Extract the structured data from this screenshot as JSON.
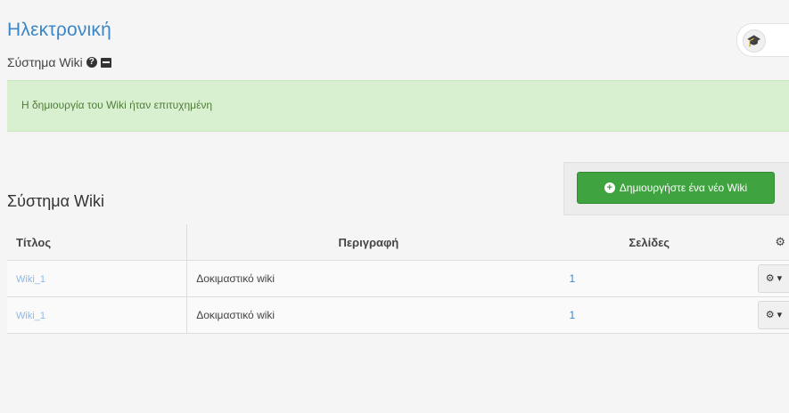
{
  "header": {
    "course_title": "Ηλεκτρονική",
    "tool_title": "Σύστημα Wiki",
    "help_icon": "question-circle-icon",
    "book_icon": "book-icon",
    "cap_icon": "graduation-cap-icon",
    "cap_glyph": "🎓"
  },
  "alert": {
    "message": "Η δημιουργία του Wiki ήταν επιτυχημένη",
    "color": "#d8f0cf"
  },
  "actions": {
    "create_label": "Δημιουργήστε ένα νέο Wiki",
    "create_color": "#3fa33f"
  },
  "section": {
    "title": "Σύστημα Wiki"
  },
  "table": {
    "headers": {
      "title": "Τίτλος",
      "description": "Περιγραφή",
      "pages": "Σελίδες",
      "actions_glyph": "⚙"
    },
    "rows": [
      {
        "title": "Wiki_1",
        "description": "Δοκιμαστικό wiki",
        "pages": "1",
        "action_glyph": "⚙ ▾"
      },
      {
        "title": "Wiki_1",
        "description": "Δοκιμαστικό wiki",
        "pages": "1",
        "action_glyph": "⚙ ▾"
      }
    ]
  }
}
